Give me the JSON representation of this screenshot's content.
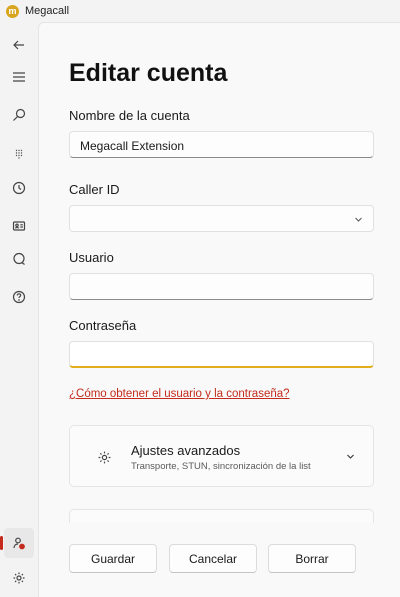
{
  "app": {
    "title": "Megacall",
    "logo_letter": "m",
    "accent": "#e3ae1c",
    "danger": "#c42b1c"
  },
  "rail": {
    "items": [
      {
        "name": "back-icon"
      },
      {
        "name": "menu-icon"
      },
      {
        "name": "search-icon"
      },
      {
        "name": "dialpad-icon"
      },
      {
        "name": "history-icon"
      },
      {
        "name": "contact-card-icon"
      },
      {
        "name": "chat-icon"
      },
      {
        "name": "help-icon"
      },
      {
        "name": "account-icon",
        "active": true
      },
      {
        "name": "settings-icon"
      }
    ]
  },
  "page": {
    "title": "Editar cuenta"
  },
  "form": {
    "account_name": {
      "label": "Nombre de la cuenta",
      "value": "Megacall Extension"
    },
    "caller_id": {
      "label": "Caller ID",
      "value": ""
    },
    "user": {
      "label": "Usuario",
      "value": ""
    },
    "password": {
      "label": "Contraseña",
      "value": ""
    }
  },
  "help_link": "¿Cómo obtener el usuario y la contraseña?",
  "advanced": {
    "title": "Ajustes avanzados",
    "subtitle": "Transporte, STUN, sincronización de la list"
  },
  "buttons": {
    "save": "Guardar",
    "cancel": "Cancelar",
    "delete": "Borrar"
  }
}
